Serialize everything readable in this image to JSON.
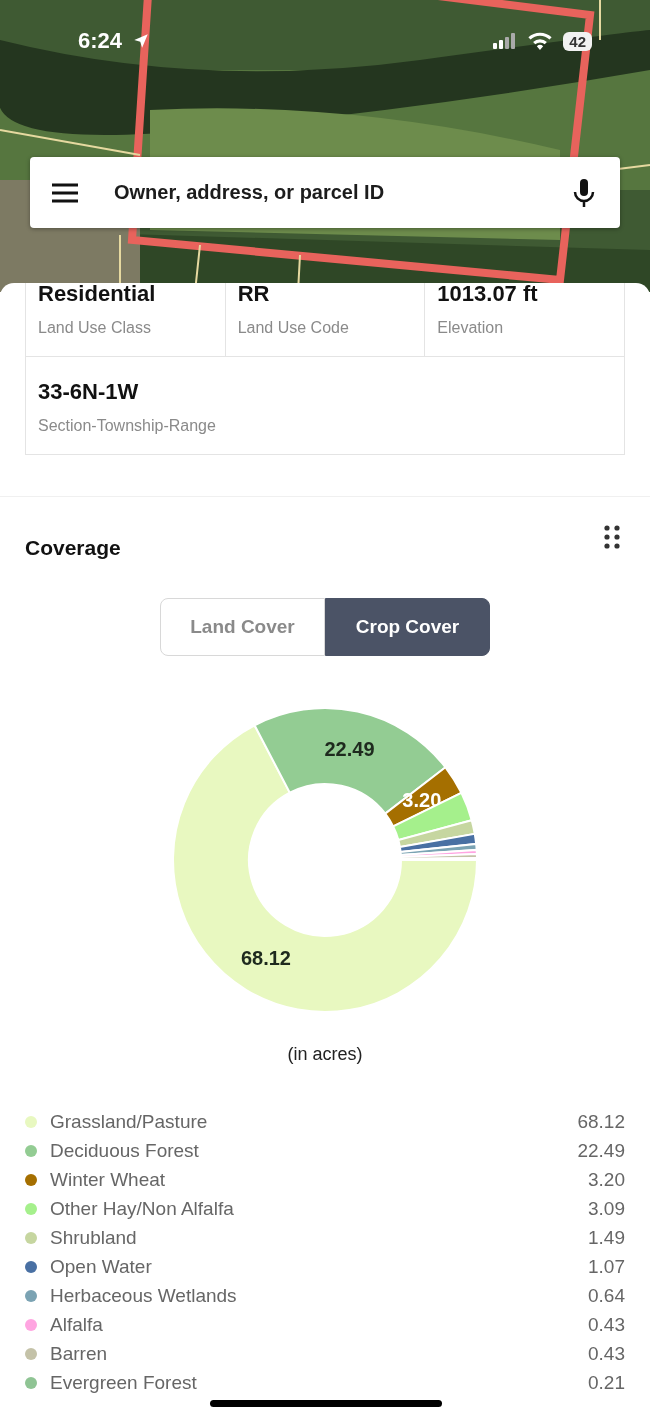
{
  "status_bar": {
    "time": "6:24",
    "battery": "42"
  },
  "search": {
    "placeholder": "Owner, address, or parcel ID"
  },
  "details": [
    {
      "value": "Residential",
      "label": "Land Use Class"
    },
    {
      "value": "RR",
      "label": "Land Use Code"
    },
    {
      "value": "1013.07 ft",
      "label": "Elevation"
    },
    {
      "value": "33-6N-1W",
      "label": "Section-Township-Range"
    }
  ],
  "coverage": {
    "title": "Coverage",
    "tabs": [
      {
        "label": "Land Cover",
        "selected": false
      },
      {
        "label": "Crop Cover",
        "selected": true
      }
    ],
    "chart_data": {
      "type": "donut",
      "categories": [
        "Grassland/Pasture",
        "Deciduous Forest",
        "Winter Wheat",
        "Other Hay/Non Alfalfa",
        "Shrubland",
        "Open Water",
        "Herbaceous Wetlands",
        "Alfalfa",
        "Barren",
        "Evergreen Forest"
      ],
      "values": [
        68.12,
        22.49,
        3.2,
        3.09,
        1.49,
        1.07,
        0.64,
        0.43,
        0.43,
        0.21
      ],
      "value_labels": [
        "68.12",
        "22.49",
        "3.20",
        null,
        null,
        null,
        null,
        null,
        null,
        null
      ]
    },
    "unit": "(in acres)",
    "legend": [
      {
        "value": "68.12",
        "color": "#e8f8c0"
      },
      {
        "value": "22.49",
        "color": "#93cc93"
      },
      {
        "value": "3.20",
        "color": "#a56f00"
      },
      {
        "value": "3.09",
        "color": "#a5f08c"
      },
      {
        "value": "1.49",
        "color": "#c6d6a0"
      },
      {
        "value": "1.07",
        "color": "#4970a3"
      },
      {
        "value": "0.64",
        "color": "#7ba3b3"
      },
      {
        "value": "0.43",
        "color": "#ffa5e1"
      },
      {
        "value": "0.43",
        "color": "#c4c2a8"
      },
      {
        "value": "0.21",
        "color": "#8fc494"
      }
    ]
  }
}
